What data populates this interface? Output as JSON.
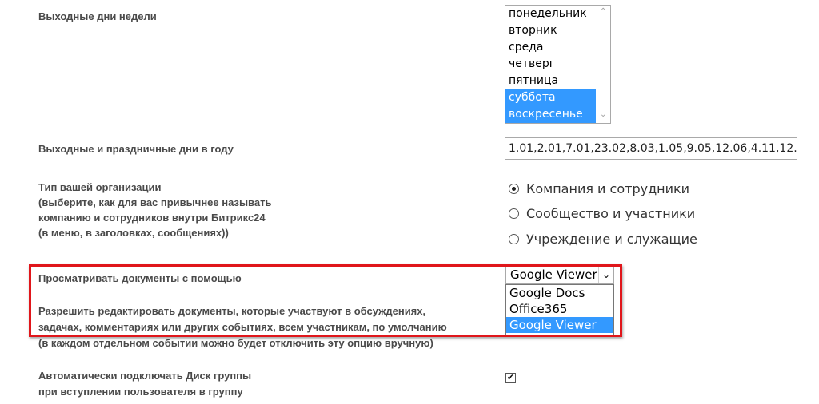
{
  "weekend_days": {
    "label": "Выходные дни недели",
    "options": [
      "понедельник",
      "вторник",
      "среда",
      "четверг",
      "пятница",
      "суббота",
      "воскресенье"
    ],
    "selected": [
      "суббота",
      "воскресенье"
    ]
  },
  "holidays": {
    "label": "Выходные и праздничные дни в году",
    "value": "1.01,2.01,7.01,23.02,8.03,1.05,9.05,12.06,4.11,12."
  },
  "org_type": {
    "label_lines": [
      "Тип вашей организации",
      "(выберите, как для вас привычнее называть",
      "компанию и сотрудников внутри Битрикс24",
      "(в меню, в заголовках, сообщениях))"
    ],
    "options": [
      "Компания и сотрудники",
      "Сообщество и участники",
      "Учреждение и служащие"
    ],
    "selected": "Компания и сотрудники"
  },
  "doc_viewer": {
    "label": "Просматривать документы с помощью",
    "value": "Google Viewer",
    "options": [
      "Google Docs",
      "Office365",
      "Google Viewer"
    ]
  },
  "doc_edit": {
    "label_lines": [
      "Разрешить редактировать документы, которые участвуют в обсуждениях,",
      "задачах, комментариях или других событиях, всем участникам, по умолчанию",
      "(в каждом отдельном событии можно будет отключить эту опцию вручную)"
    ]
  },
  "auto_disk": {
    "label_lines": [
      "Автоматически подключать Диск группы",
      "при вступлении пользователя в группу"
    ],
    "checked": true
  },
  "colors": {
    "highlight": "#e0161b",
    "selection": "#3399ff"
  }
}
